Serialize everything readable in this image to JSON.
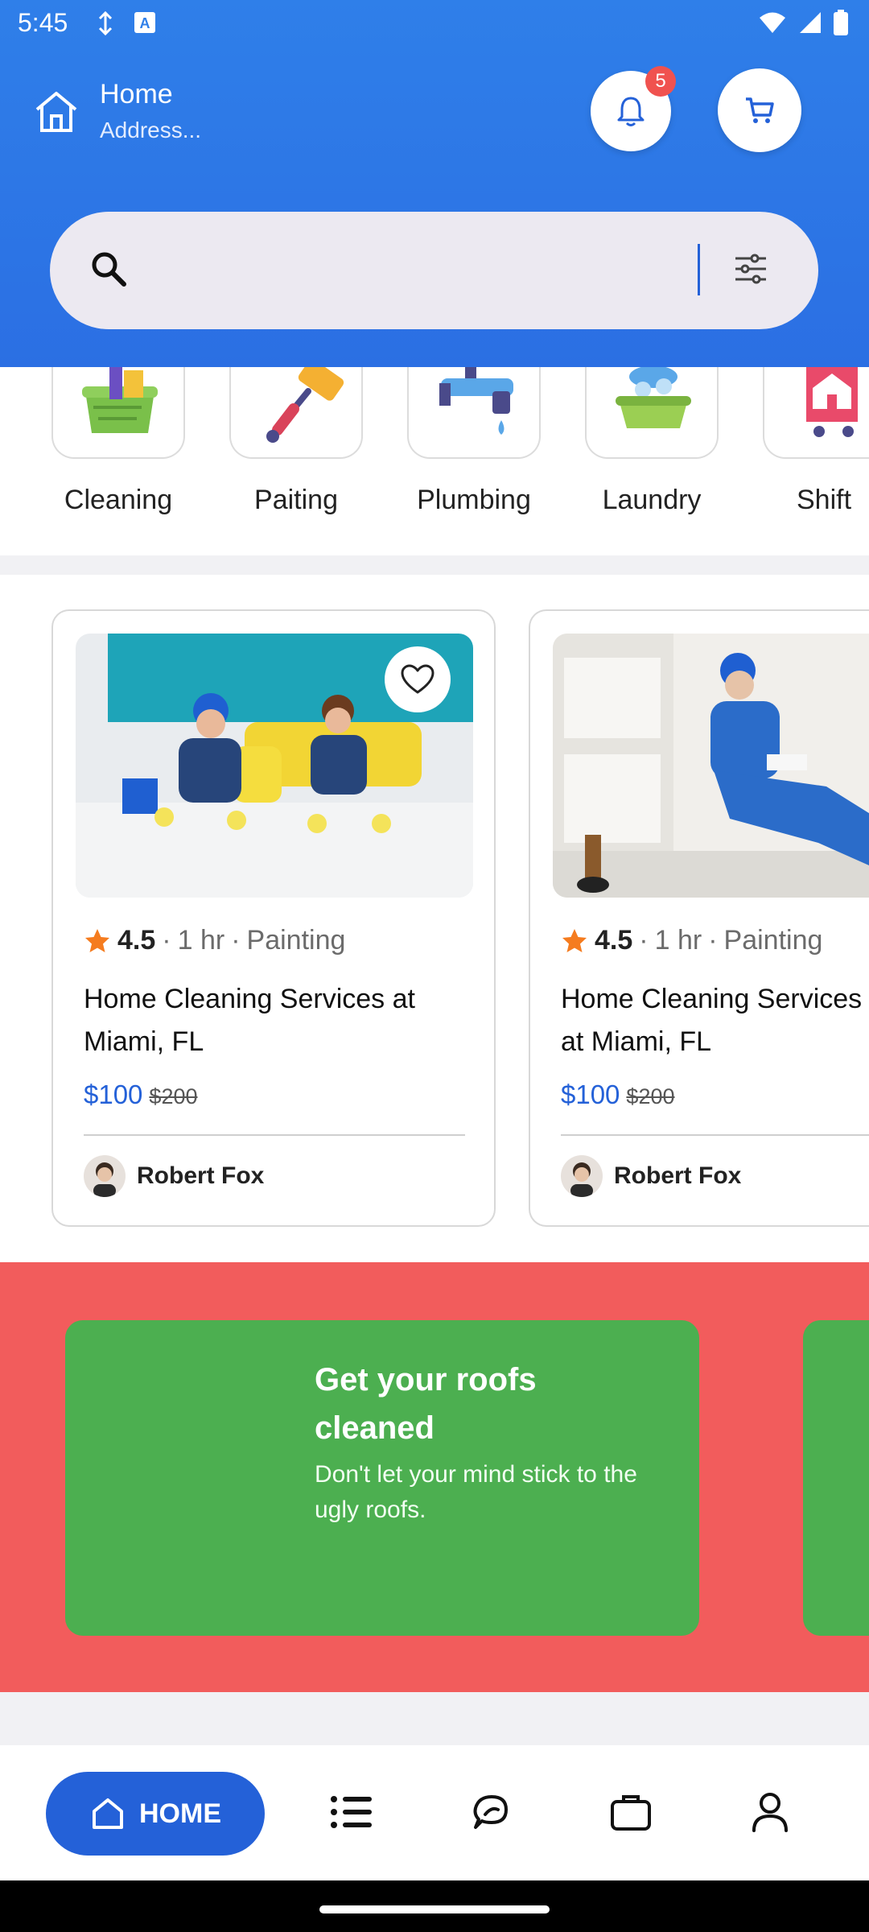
{
  "status_bar": {
    "time": "5:45"
  },
  "header": {
    "location_title": "Home",
    "location_subtitle": "Address...",
    "notification_count": "5"
  },
  "search": {
    "placeholder": ""
  },
  "categories": [
    {
      "label": "Cleaning",
      "icon": "cleaning-basket-icon"
    },
    {
      "label": "Paiting",
      "icon": "paint-roller-icon"
    },
    {
      "label": "Plumbing",
      "icon": "faucet-icon"
    },
    {
      "label": "Laundry",
      "icon": "laundry-tub-icon"
    },
    {
      "label": "Shift",
      "icon": "moving-house-icon"
    }
  ],
  "services": [
    {
      "rating": "4.5",
      "duration": "1 hr",
      "category": "Painting",
      "title": "Home Cleaning Services at Miami, FL",
      "price": "$100",
      "old_price": "$200",
      "provider": "Robert Fox"
    },
    {
      "rating": "4.5",
      "duration": "1 hr",
      "category": "Painting",
      "title": "Home Cleaning Services at Miami, FL",
      "price": "$100",
      "old_price": "$200",
      "provider": "Robert Fox"
    }
  ],
  "promo": {
    "title": "Get your roofs cleaned",
    "subtitle": "Don't let your mind stick to the ugly roofs."
  },
  "bottom_nav": {
    "home_label": "HOME"
  },
  "colors": {
    "primary": "#2461d8",
    "header": "#2f7fe9",
    "promo_band": "#f25c5c",
    "promo_card": "#4caf50",
    "badge": "#f0524f",
    "star": "#f57c1f"
  }
}
